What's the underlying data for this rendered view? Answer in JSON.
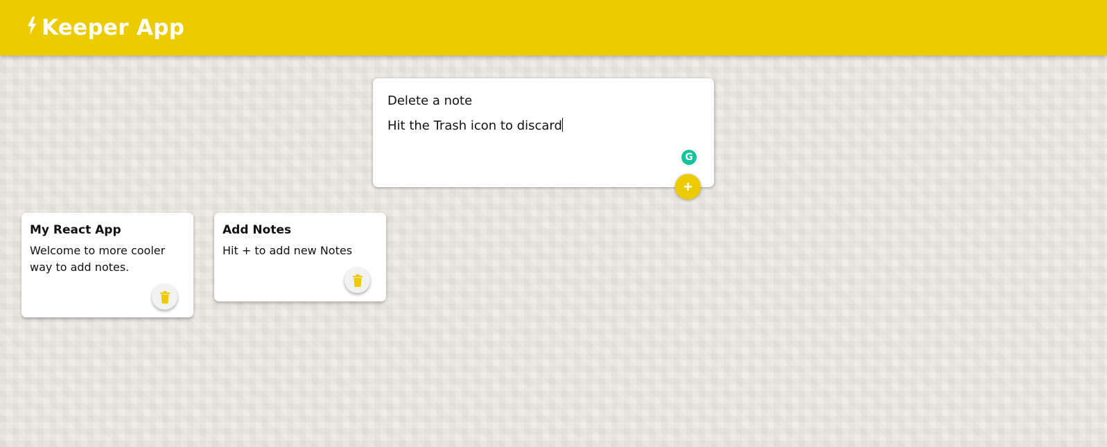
{
  "header": {
    "title": "Keeper App",
    "icon": "bolt-icon",
    "color": "#eccb00"
  },
  "create_area": {
    "title_value": "Delete a note",
    "content_value": "Hit the Trash icon to discard",
    "extension_icon": "grammarly-icon",
    "extension_letter": "G",
    "add_label": "+"
  },
  "notes": [
    {
      "title": "My React App",
      "content": "Welcome to more cooler way to add notes.",
      "delete_icon": "trash-icon"
    },
    {
      "title": "Add Notes",
      "content": "Hit + to add new Notes",
      "delete_icon": "trash-icon"
    }
  ]
}
